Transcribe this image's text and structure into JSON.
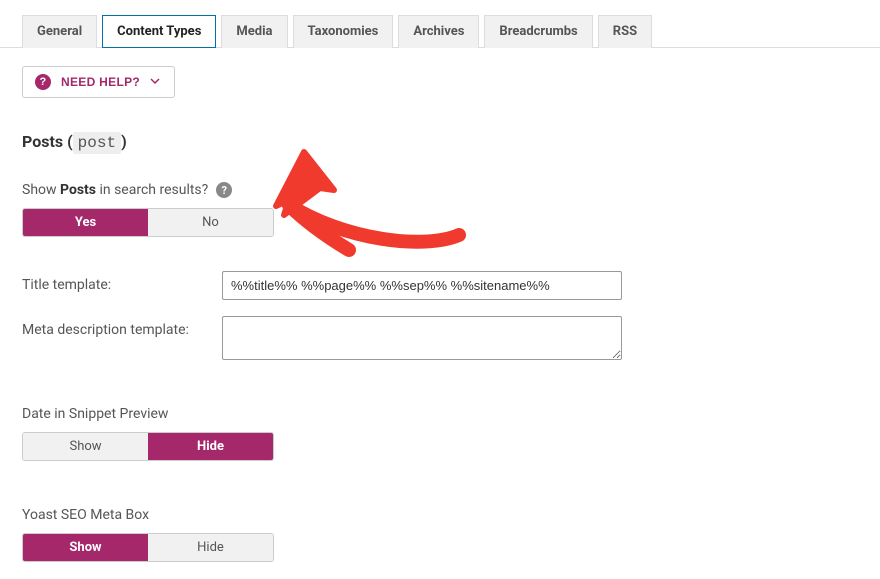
{
  "tabs": {
    "general": "General",
    "content_types": "Content Types",
    "media": "Media",
    "taxonomies": "Taxonomies",
    "archives": "Archives",
    "breadcrumbs": "Breadcrumbs",
    "rss": "RSS"
  },
  "help_button": {
    "label": "NEED HELP?"
  },
  "section": {
    "title_prefix": "Posts (",
    "code": "post",
    "title_suffix": ")"
  },
  "show_in_results": {
    "pre": "Show ",
    "bold": "Posts",
    "post": " in search results?",
    "yes": "Yes",
    "no": "No"
  },
  "title_template": {
    "label": "Title template:",
    "value": "%%title%% %%page%% %%sep%% %%sitename%%"
  },
  "meta_desc": {
    "label": "Meta description template:",
    "value": ""
  },
  "date_preview": {
    "label": "Date in Snippet Preview",
    "show": "Show",
    "hide": "Hide"
  },
  "meta_box": {
    "label": "Yoast SEO Meta Box",
    "show": "Show",
    "hide": "Hide"
  }
}
